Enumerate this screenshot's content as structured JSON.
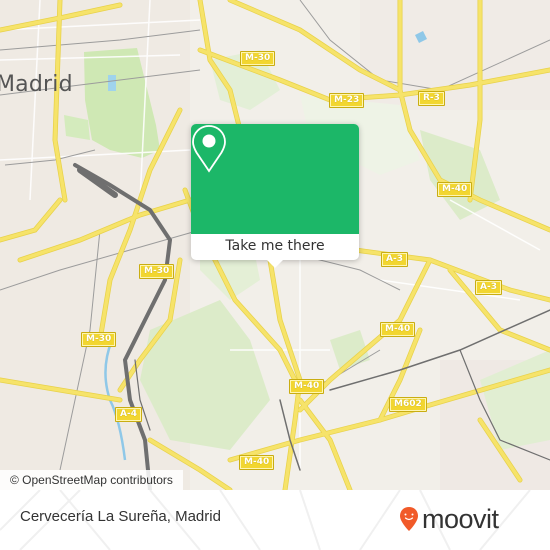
{
  "map": {
    "city_label": "Madrid",
    "road_shields": [
      {
        "id": "m30-top",
        "label": "M-30"
      },
      {
        "id": "m23",
        "label": "M-23"
      },
      {
        "id": "r3",
        "label": "R-3"
      },
      {
        "id": "m40-right",
        "label": "M-40"
      },
      {
        "id": "a3-left",
        "label": "A-3"
      },
      {
        "id": "a3-right",
        "label": "A-3"
      },
      {
        "id": "m30-mid",
        "label": "M-30"
      },
      {
        "id": "m30-left",
        "label": "M-30"
      },
      {
        "id": "m40-mid",
        "label": "M-40"
      },
      {
        "id": "m40-center",
        "label": "M-40"
      },
      {
        "id": "m602",
        "label": "M602"
      },
      {
        "id": "a4",
        "label": "A-4"
      },
      {
        "id": "m40-bottom",
        "label": "M-40"
      }
    ],
    "attribution": "© OpenStreetMap contributors",
    "colors": {
      "background": "#f2efe9",
      "park": "#cfe8b4",
      "major_road": "#f6e36a",
      "rail": "#777777",
      "water": "#8fc8e8"
    }
  },
  "popup": {
    "icon": "map-pin-icon",
    "button_label": "Take me there",
    "color": "#1cb768"
  },
  "footer": {
    "place_name": "Cervecería La Sureña, Madrid",
    "brand": "moovit",
    "brand_icon": "moovit-pin-icon",
    "brand_color": "#f15a29"
  }
}
